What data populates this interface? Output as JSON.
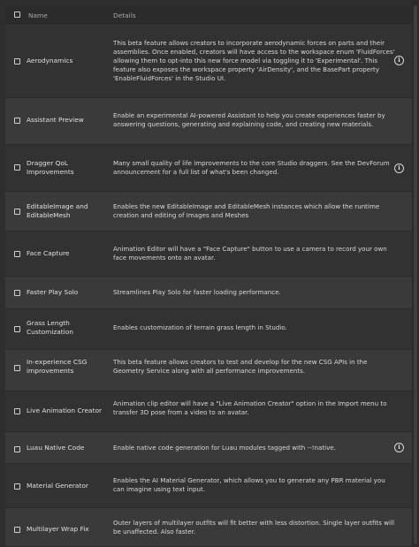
{
  "header": {
    "name": "Name",
    "details": "Details"
  },
  "features": [
    {
      "name": "Aerodynamics",
      "details": "This beta feature allows creators to incorporate aerodynamic forces on parts and their assemblies. Once enabled, creators will have access to the workspace enum 'FluidForces' allowing them to opt-into this new force model via toggling it to 'Experimental'. This feature also exposes the workspace property 'AirDensity', and the BasePart property 'EnableFluidForces' in the Studio UI.",
      "info": true
    },
    {
      "name": "Assistant Preview",
      "details": "Enable an experimental AI-powered Assistant to help you create experiences faster by answering questions, generating and explaining code, and creating new materials.",
      "info": false
    },
    {
      "name": "Dragger QoL Improvements",
      "details": "Many small quality of life improvements to the core Studio draggers. See the DevForum announcement for a full list of what's been changed.",
      "info": true
    },
    {
      "name": "EditableImage and EditableMesh",
      "details": "Enables the new EditableImage and EditableMesh instances which allow the runtime creation and editing of Images and Meshes",
      "info": false
    },
    {
      "name": "Face Capture",
      "details": "Animation Editor will have a \"Face Capture\" button to use a camera to record your own face movements onto an avatar.",
      "info": false
    },
    {
      "name": "Faster Play Solo",
      "details": "Streamlines Play Solo for faster loading performance.",
      "info": false
    },
    {
      "name": "Grass Length Customization",
      "details": "Enables customization of terrain grass length in Studio.",
      "info": false
    },
    {
      "name": "In-experience CSG improvements",
      "details": "This beta feature allows creators to test and develop for the new CSG APIs in the Geometry Service along with all performance improvements.",
      "info": false
    },
    {
      "name": "Live Animation Creator",
      "details": "Animation clip editor will have a \"Live Animation Creator\" option in the Import menu to transfer 3D pose from a video to an avatar.",
      "info": false
    },
    {
      "name": "Luau Native Code",
      "details": "Enable native code generation for Luau modules tagged with --!native.",
      "info": true
    },
    {
      "name": "Material Generator",
      "details": "Enables the AI Material Generator, which allows you to generate any PBR material you can imagine using text input.",
      "info": false
    },
    {
      "name": "Multilayer Wrap Fix",
      "details": "Outer layers of multilayer outfits will fit better with less distortion. Single layer outfits will be unaffected. Also faster.",
      "info": false
    }
  ],
  "icons": {
    "checkbox": "checkbox-icon",
    "info": "info-icon"
  },
  "colors": {
    "background": "#2e2e2e",
    "row_odd": "#323232",
    "row_even": "#3a3a3a",
    "text": "#d8d8d8"
  }
}
